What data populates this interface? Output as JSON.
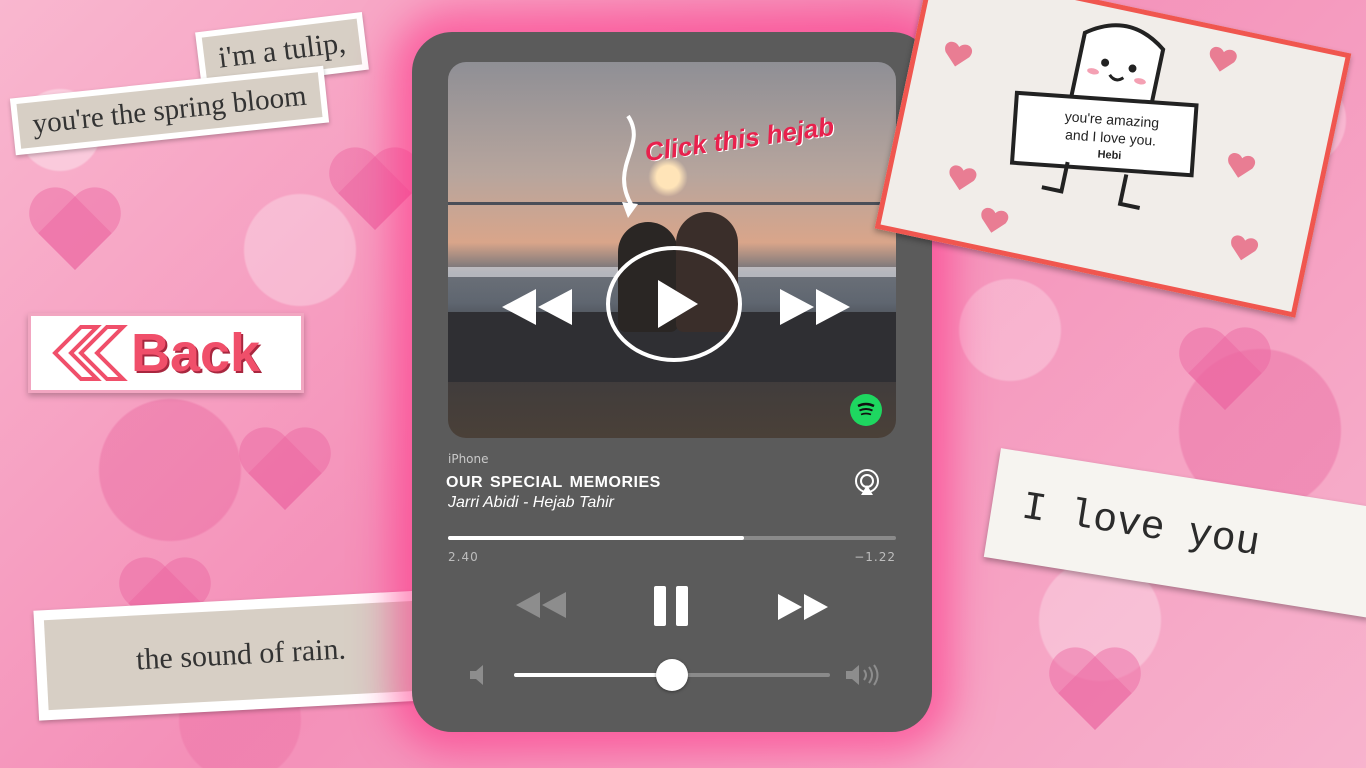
{
  "background": {
    "colors": {
      "base": "#f7a8c8",
      "accent": "#f04f6a"
    }
  },
  "quotes": {
    "tulip": "i'm a tulip,",
    "spring": "you're the spring bloom",
    "rain": "the sound of rain.",
    "love": "I love you"
  },
  "back_button": {
    "label": "Back",
    "icon": "double-chevron-left-icon"
  },
  "player": {
    "artwork_caption": "Click this hejab",
    "device": "iPhone",
    "song_title": "our special memories",
    "artist": "Jarri Abidi - Hejab Tahir",
    "elapsed": "2.40",
    "remaining": "−1.22",
    "progress_fraction": 0.66,
    "volume_fraction": 0.5,
    "accent_color": "#1ed760"
  },
  "note_card": {
    "line1": "you're amazing",
    "line2": "and I love you.",
    "signature": "Hebi"
  }
}
